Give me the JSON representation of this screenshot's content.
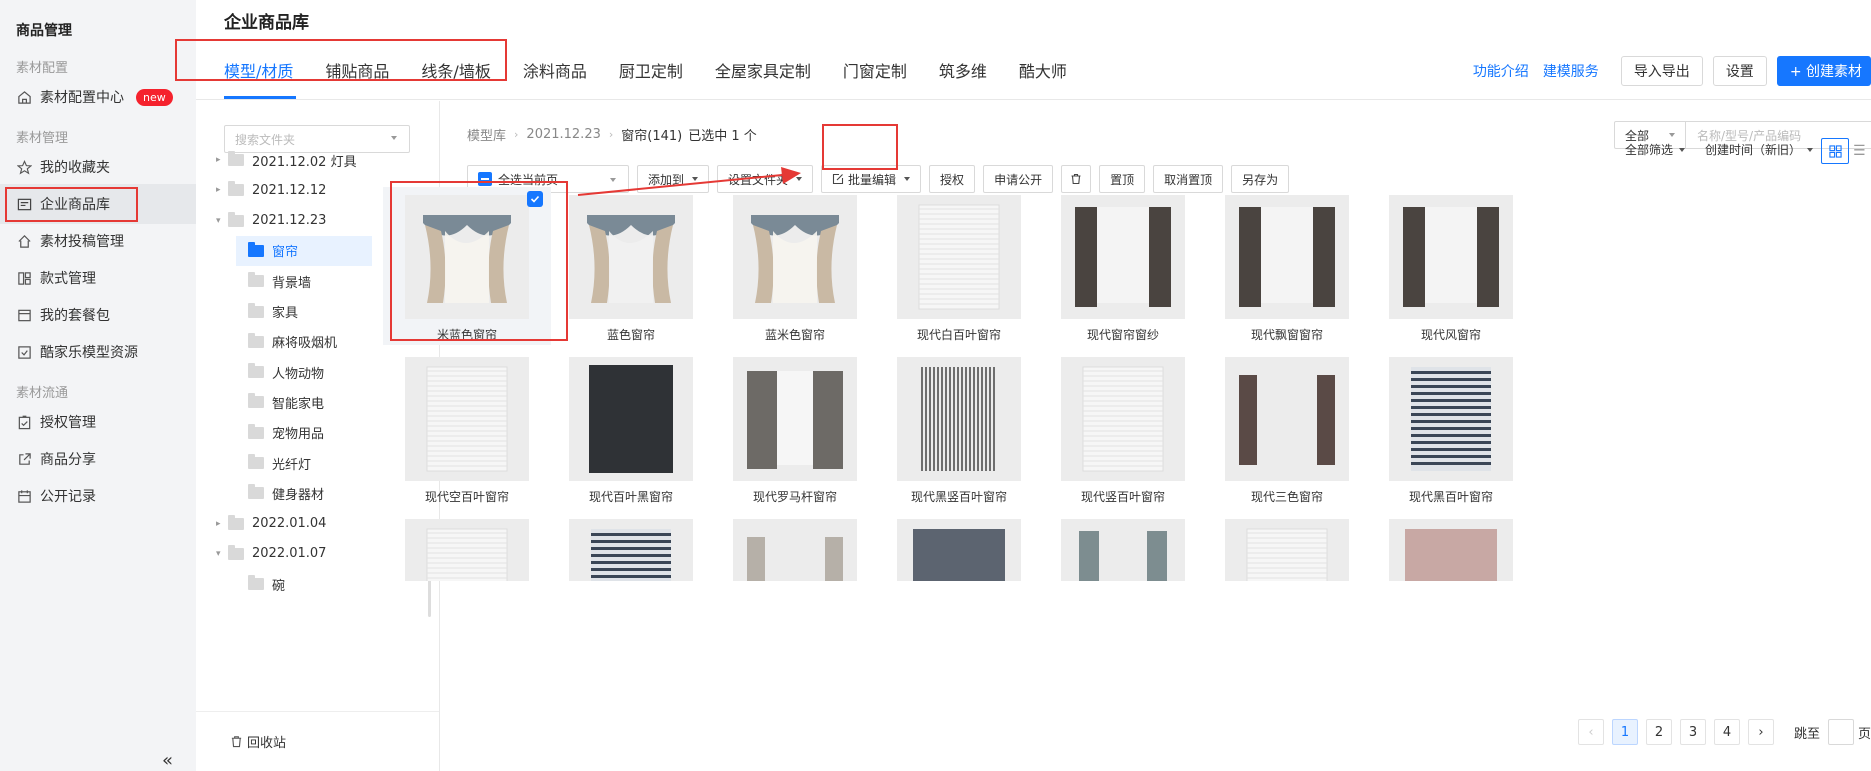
{
  "leftnav": {
    "app_title": "商品管理",
    "section_config": "素材配置",
    "section_manage": "素材管理",
    "section_flow": "素材流通",
    "items": [
      {
        "label": "素材配置中心",
        "badge": "new"
      },
      {
        "label": "我的收藏夹"
      },
      {
        "label": "企业商品库"
      },
      {
        "label": "素材投稿管理"
      },
      {
        "label": "款式管理"
      },
      {
        "label": "我的套餐包"
      },
      {
        "label": "酷家乐模型资源"
      },
      {
        "label": "授权管理"
      },
      {
        "label": "商品分享"
      },
      {
        "label": "公开记录"
      }
    ],
    "collapse": "«"
  },
  "header": {
    "title": "企业商品库",
    "tabs": [
      "模型/材质",
      "铺贴商品",
      "线条/墙板",
      "涂料商品",
      "厨卫定制",
      "全屋家具定制",
      "门窗定制",
      "筑多维",
      "酷大师"
    ],
    "links": [
      "功能介绍",
      "建模服务"
    ],
    "buttons": {
      "import_export": "导入导出",
      "settings": "设置",
      "create": "+ 创建素材"
    }
  },
  "folders": {
    "search_placeholder": "搜索文件夹",
    "tree": [
      {
        "label": "2021.12.02 灯具",
        "tri": "▸"
      },
      {
        "label": "2021.12.12",
        "tri": "▸"
      },
      {
        "label": "2021.12.23",
        "tri": "▾"
      },
      {
        "label": "窗帘",
        "tri": ""
      },
      {
        "label": "背景墙",
        "tri": ""
      },
      {
        "label": "家具",
        "tri": ""
      },
      {
        "label": "麻将吸烟机",
        "tri": ""
      },
      {
        "label": "人物动物",
        "tri": ""
      },
      {
        "label": "智能家电",
        "tri": ""
      },
      {
        "label": "宠物用品",
        "tri": ""
      },
      {
        "label": "光纤灯",
        "tri": ""
      },
      {
        "label": "健身器材",
        "tri": ""
      },
      {
        "label": "2022.01.04",
        "tri": "▸"
      },
      {
        "label": "2022.01.07",
        "tri": "▾"
      },
      {
        "label": "碗",
        "tri": ""
      }
    ],
    "resize_icon": "↔",
    "recycle": "回收站"
  },
  "main": {
    "breadcrumb": [
      "模型库",
      "2021.12.23",
      "窗帘(141)"
    ],
    "selected_count": "已选中 1 个",
    "scope": "全部",
    "search_placeholder": "名称/型号/产品编码",
    "toolbar": {
      "select_all": "全选当前页",
      "add_to": "添加到",
      "set_folder": "设置文件夹",
      "batch_edit": "批量编辑",
      "authorize": "授权",
      "request_public": "申请公开",
      "pin": "置顶",
      "unpin": "取消置顶",
      "save_as": "另存为"
    },
    "filter": "全部筛选",
    "sort": "创建时间（新旧）",
    "items": [
      "米蓝色窗帘",
      "蓝色窗帘",
      "蓝米色窗帘",
      "现代白百叶窗帘",
      "现代窗帘窗纱",
      "现代飘窗窗帘",
      "现代风窗帘",
      "现代空百叶窗帘",
      "现代百叶黑窗帘",
      "现代罗马杆窗帘",
      "现代黑竖百叶窗帘",
      "现代竖百叶窗帘",
      "现代三色窗帘",
      "现代黑百叶窗帘",
      "",
      "",
      "",
      "",
      "",
      "",
      ""
    ],
    "pager": {
      "prev": "‹",
      "pages": [
        "1",
        "2",
        "3",
        "4"
      ],
      "next": "›",
      "goto_label": "跳至",
      "goto_suffix": "页"
    }
  },
  "colors": {
    "accent": "#1677ff",
    "annotation": "#e53935",
    "new_badge": "#f5222d"
  }
}
